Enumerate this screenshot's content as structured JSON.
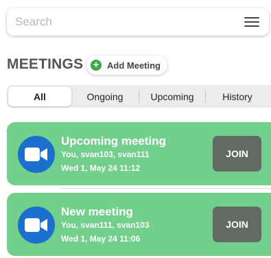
{
  "search": {
    "placeholder": "Search"
  },
  "header": {
    "title": "MEETINGS",
    "add_label": "Add Meeting"
  },
  "tabs": [
    {
      "label": "All",
      "active": true
    },
    {
      "label": "Ongoing",
      "active": false
    },
    {
      "label": "Upcoming",
      "active": false
    },
    {
      "label": "History",
      "active": false
    }
  ],
  "meetings": [
    {
      "title": "Upcoming meeting",
      "participants": "You, svan103, svan111",
      "time": "Wed 1, May 24 11:12",
      "join_label": "JOIN"
    },
    {
      "title": "New meeting",
      "participants": "You, svan111, svan103",
      "time": "Wed 1, May 24 11:06",
      "join_label": "JOIN"
    }
  ],
  "colors": {
    "card_bg": "#72cf8c",
    "join_bg": "#616b64",
    "camera_bg": "#1a6fcf",
    "add_icon": "#3aa846"
  },
  "icons": {
    "menu": "hamburger-icon",
    "add": "plus-circle-icon",
    "camera": "video-camera-icon"
  }
}
